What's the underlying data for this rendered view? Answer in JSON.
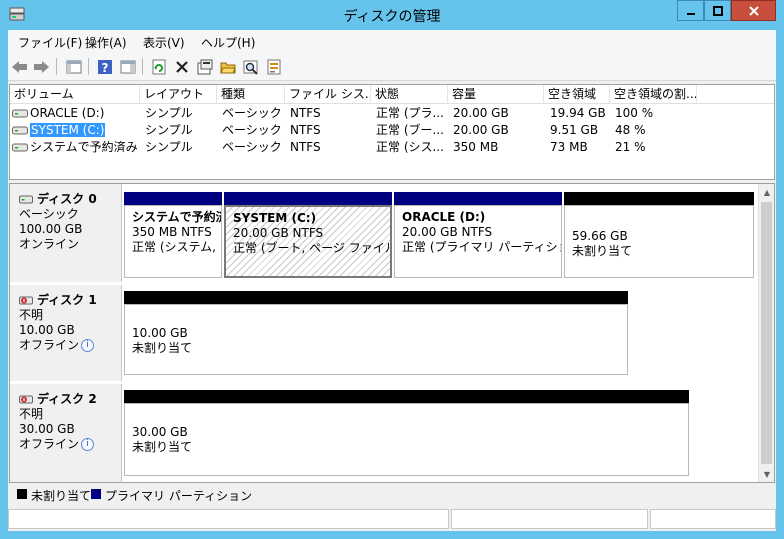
{
  "window": {
    "title": "ディスクの管理",
    "min_glyph": "—",
    "max_glyph": "□",
    "close_glyph": "X"
  },
  "menu": [
    "ファイル(F)",
    "操作(A)",
    "表示(V)",
    "ヘルプ(H)"
  ],
  "toolbar": [
    "back-icon",
    "forward-icon",
    "console-tree-icon",
    "help-icon",
    "action-pane-icon",
    "refresh-icon",
    "delete-icon",
    "properties-icon",
    "open-icon",
    "explore-icon",
    "export-icon"
  ],
  "columns": [
    "ボリューム",
    "レイアウト",
    "種類",
    "ファイル シス...",
    "状態",
    "容量",
    "空き領域",
    "空き領域の割..."
  ],
  "volumes": [
    {
      "name": "ORACLE (D:)",
      "layout": "シンプル",
      "type": "ベーシック",
      "fs": "NTFS",
      "status": "正常 (プラ...",
      "capacity": "20.00 GB",
      "free": "19.94 GB",
      "free_pct": "100 %",
      "selected": false
    },
    {
      "name": "SYSTEM (C:)",
      "layout": "シンプル",
      "type": "ベーシック",
      "fs": "NTFS",
      "status": "正常 (ブー...",
      "capacity": "20.00 GB",
      "free": "9.51 GB",
      "free_pct": "48 %",
      "selected": true
    },
    {
      "name": "システムで予約済み",
      "layout": "シンプル",
      "type": "ベーシック",
      "fs": "NTFS",
      "status": "正常 (シス...",
      "capacity": "350 MB",
      "free": "73 MB",
      "free_pct": "21 %",
      "selected": false
    }
  ],
  "disks": [
    {
      "name": "ディスク 0",
      "kind": "ベーシック",
      "size": "100.00 GB",
      "state": "オンライン",
      "info": false,
      "partitions": [
        {
          "name": "システムで予約済",
          "line2": "350 MB NTFS",
          "line3": "正常 (システム, ア",
          "bar": "primary",
          "hatched": false
        },
        {
          "name": "SYSTEM  (C:)",
          "line2": "20.00 GB NTFS",
          "line3": "正常 (ブート, ページ ファイル, ク",
          "bar": "primary",
          "hatched": true
        },
        {
          "name": "ORACLE  (D:)",
          "line2": "20.00 GB NTFS",
          "line3": "正常 (プライマリ パーティション)",
          "bar": "primary",
          "hatched": false
        },
        {
          "name": "",
          "line2": "59.66 GB",
          "line3": "未割り当て",
          "bar": "unallocated",
          "hatched": false
        }
      ]
    },
    {
      "name": "ディスク 1",
      "kind": "不明",
      "size": "10.00 GB",
      "state": "オフライン",
      "info": true,
      "partitions": [
        {
          "name": "",
          "line2": "10.00 GB",
          "line3": "未割り当て",
          "bar": "unallocated",
          "hatched": false
        }
      ]
    },
    {
      "name": "ディスク 2",
      "kind": "不明",
      "size": "30.00 GB",
      "state": "オフライン",
      "info": true,
      "partitions": [
        {
          "name": "",
          "line2": "30.00 GB",
          "line3": "未割り当て",
          "bar": "unallocated",
          "hatched": false
        }
      ]
    }
  ],
  "legend": [
    {
      "label": "未割り当て",
      "color": "#000000"
    },
    {
      "label": "プライマリ パーティション",
      "color": "#000080"
    }
  ],
  "colors": {
    "titlebar": "#66c4ec",
    "selection": "#3399ff",
    "primary_bar": "#000080",
    "unallocated_bar": "#000000"
  }
}
